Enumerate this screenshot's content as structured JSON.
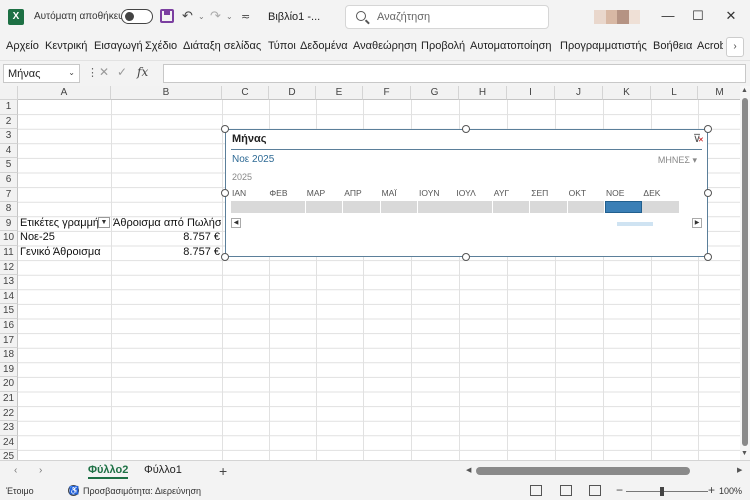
{
  "titlebar": {
    "app_logo": "X",
    "autosave_label": "Αυτόματη αποθήκευση",
    "doc_title": "Βιβλίο1  -...",
    "search_placeholder": "Αναζήτηση",
    "undo_glyph": "↶",
    "redo_glyph": "↷",
    "dropdown_glyph": "⌄",
    "customize_glyph": "≂",
    "minimize_glyph": "—",
    "maximize_glyph": "☐",
    "close_glyph": "✕",
    "avatar_colors": [
      "#e9d7cc",
      "#d8b8a4",
      "#b59383",
      "#efe0d6"
    ]
  },
  "ribbon": {
    "tabs": [
      "Αρχείο",
      "Κεντρική",
      "Εισαγωγή",
      "Σχέδιο",
      "Διάταξη σελίδας",
      "Τύποι",
      "Δεδομένα",
      "Αναθεώρηση",
      "Προβολή",
      "Αυτοματοποίηση",
      "Προγραμματιστής",
      "Βοήθεια",
      "Acrobat"
    ],
    "more_glyph": "›"
  },
  "formula_bar": {
    "name_box": "Μήνας",
    "name_caret": "⌄",
    "sep": "⋮",
    "cancel": "✕",
    "enter": "✓",
    "fx": "fx",
    "value": ""
  },
  "grid": {
    "columns": [
      "A",
      "B",
      "C",
      "D",
      "E",
      "F",
      "G",
      "H",
      "I",
      "J",
      "K",
      "L",
      "M"
    ],
    "rows": [
      "1",
      "2",
      "3",
      "4",
      "5",
      "6",
      "7",
      "8",
      "9",
      "10",
      "11",
      "12",
      "13",
      "14",
      "15",
      "16",
      "17",
      "18",
      "19",
      "20",
      "21",
      "22",
      "23",
      "24",
      "25"
    ],
    "pivot": {
      "header_row": "Ετικέτες γραμμής",
      "header_value": "Άθροισμα από Πωλήσεις",
      "filter_glyph": "▼",
      "rows": [
        {
          "label": "Νοε-25",
          "value": "8.757 €"
        },
        {
          "label": "Γενικό Άθροισμα",
          "value": "8.757 €"
        }
      ]
    }
  },
  "slicer": {
    "title": "Μήνας",
    "clear_filter_glyph": "⊽",
    "selection": "Νοε 2025",
    "level": "ΜΗΝΕΣ ▾",
    "year": "2025",
    "months": [
      "ΙΑΝ",
      "ΦΕΒ",
      "ΜΑΡ",
      "ΑΠΡ",
      "ΜΑΪ",
      "ΙΟΥΝ",
      "ΙΟΥΛ",
      "ΑΥΓ",
      "ΣΕΠ",
      "ΟΚΤ",
      "ΝΟΕ",
      "ΔΕΚ"
    ],
    "selected_month": "ΝΟΕ",
    "left_arrow": "◀",
    "right_arrow": "▶"
  },
  "sheets": {
    "prev": "‹",
    "next": "›",
    "tabs": [
      "Φύλλο2",
      "Φύλλο1"
    ],
    "active": "Φύλλο2",
    "add": "+"
  },
  "statusbar": {
    "status": "Έτοιμο",
    "accessibility_icon": "♿",
    "accessibility": "Προσβασιμότητα: Διερεύνηση",
    "zoom_minus": "−",
    "zoom_plus": "+",
    "zoom": "100%"
  }
}
